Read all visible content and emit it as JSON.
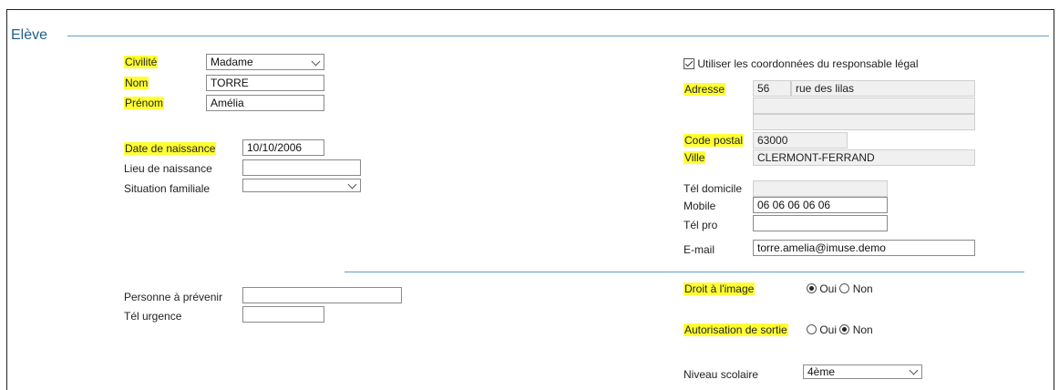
{
  "section": {
    "title": "Elève"
  },
  "left": {
    "civilite": {
      "label": "Civilité",
      "value": "Madame"
    },
    "nom": {
      "label": "Nom",
      "value": "TORRE"
    },
    "prenom": {
      "label": "Prénom",
      "value": "Amélia"
    },
    "date_naissance": {
      "label": "Date de naissance",
      "value": "10/10/2006"
    },
    "lieu_naissance": {
      "label": "Lieu de naissance",
      "value": ""
    },
    "situation_familiale": {
      "label": "Situation familiale",
      "value": ""
    },
    "personne_prevenir": {
      "label": "Personne à prévenir",
      "value": ""
    },
    "tel_urgence": {
      "label": "Tél urgence",
      "value": ""
    }
  },
  "right": {
    "use_responsable": {
      "label": "Utiliser les coordonnées du responsable légal",
      "checked": true
    },
    "adresse": {
      "label": "Adresse",
      "number": "56",
      "street": "rue des lilas",
      "line2": "",
      "line3": ""
    },
    "code_postal": {
      "label": "Code postal",
      "value": "63000"
    },
    "ville": {
      "label": "Ville",
      "value": "CLERMONT-FERRAND"
    },
    "tel_domicile": {
      "label": "Tél domicile",
      "value": ""
    },
    "mobile": {
      "label": "Mobile",
      "value": "06 06 06 06 06"
    },
    "tel_pro": {
      "label": "Tél pro",
      "value": ""
    },
    "email": {
      "label": "E-mail",
      "value": "torre.amelia@imuse.demo"
    },
    "droit_image": {
      "label": "Droit à l'image",
      "oui": "Oui",
      "non": "Non",
      "selected": "Oui"
    },
    "autorisation_sortie": {
      "label": "Autorisation de sortie",
      "oui": "Oui",
      "non": "Non",
      "selected": "Non"
    },
    "niveau_scolaire": {
      "label": "Niveau scolaire",
      "value": "4ème"
    }
  }
}
